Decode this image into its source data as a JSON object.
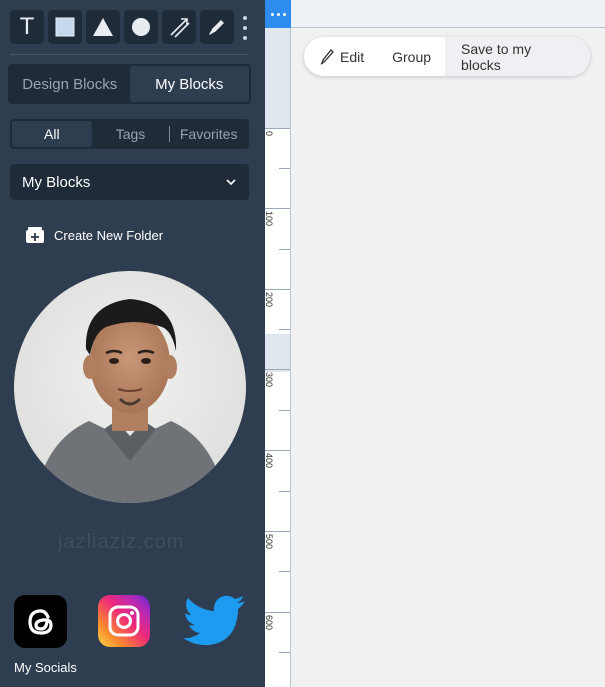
{
  "toolbar": {
    "text_tool": "T",
    "tools": [
      "text-icon",
      "rectangle-icon",
      "triangle-icon",
      "circle-icon",
      "arrow-icon",
      "pen-icon"
    ]
  },
  "block_tabs": {
    "design_blocks": "Design Blocks",
    "my_blocks": "My Blocks",
    "active": "My Blocks"
  },
  "filter_tabs": {
    "all": "All",
    "tags": "Tags",
    "favorites": "Favorites",
    "active": "All"
  },
  "folder_dropdown": {
    "selected": "My Blocks"
  },
  "create_folder_label": "Create New Folder",
  "watermark": "jazliaziz.com",
  "socials_label": "My Socials",
  "ruler": {
    "labels": [
      "0",
      "100",
      "200",
      "300",
      "400",
      "500",
      "600"
    ]
  },
  "context_toolbar": {
    "edit": "Edit",
    "group": "Group",
    "save": "Save to my blocks"
  },
  "colors": {
    "sidebar_bg": "#2e3d4f",
    "control_bg": "#1f2b39",
    "accent": "#2d8cf0"
  }
}
